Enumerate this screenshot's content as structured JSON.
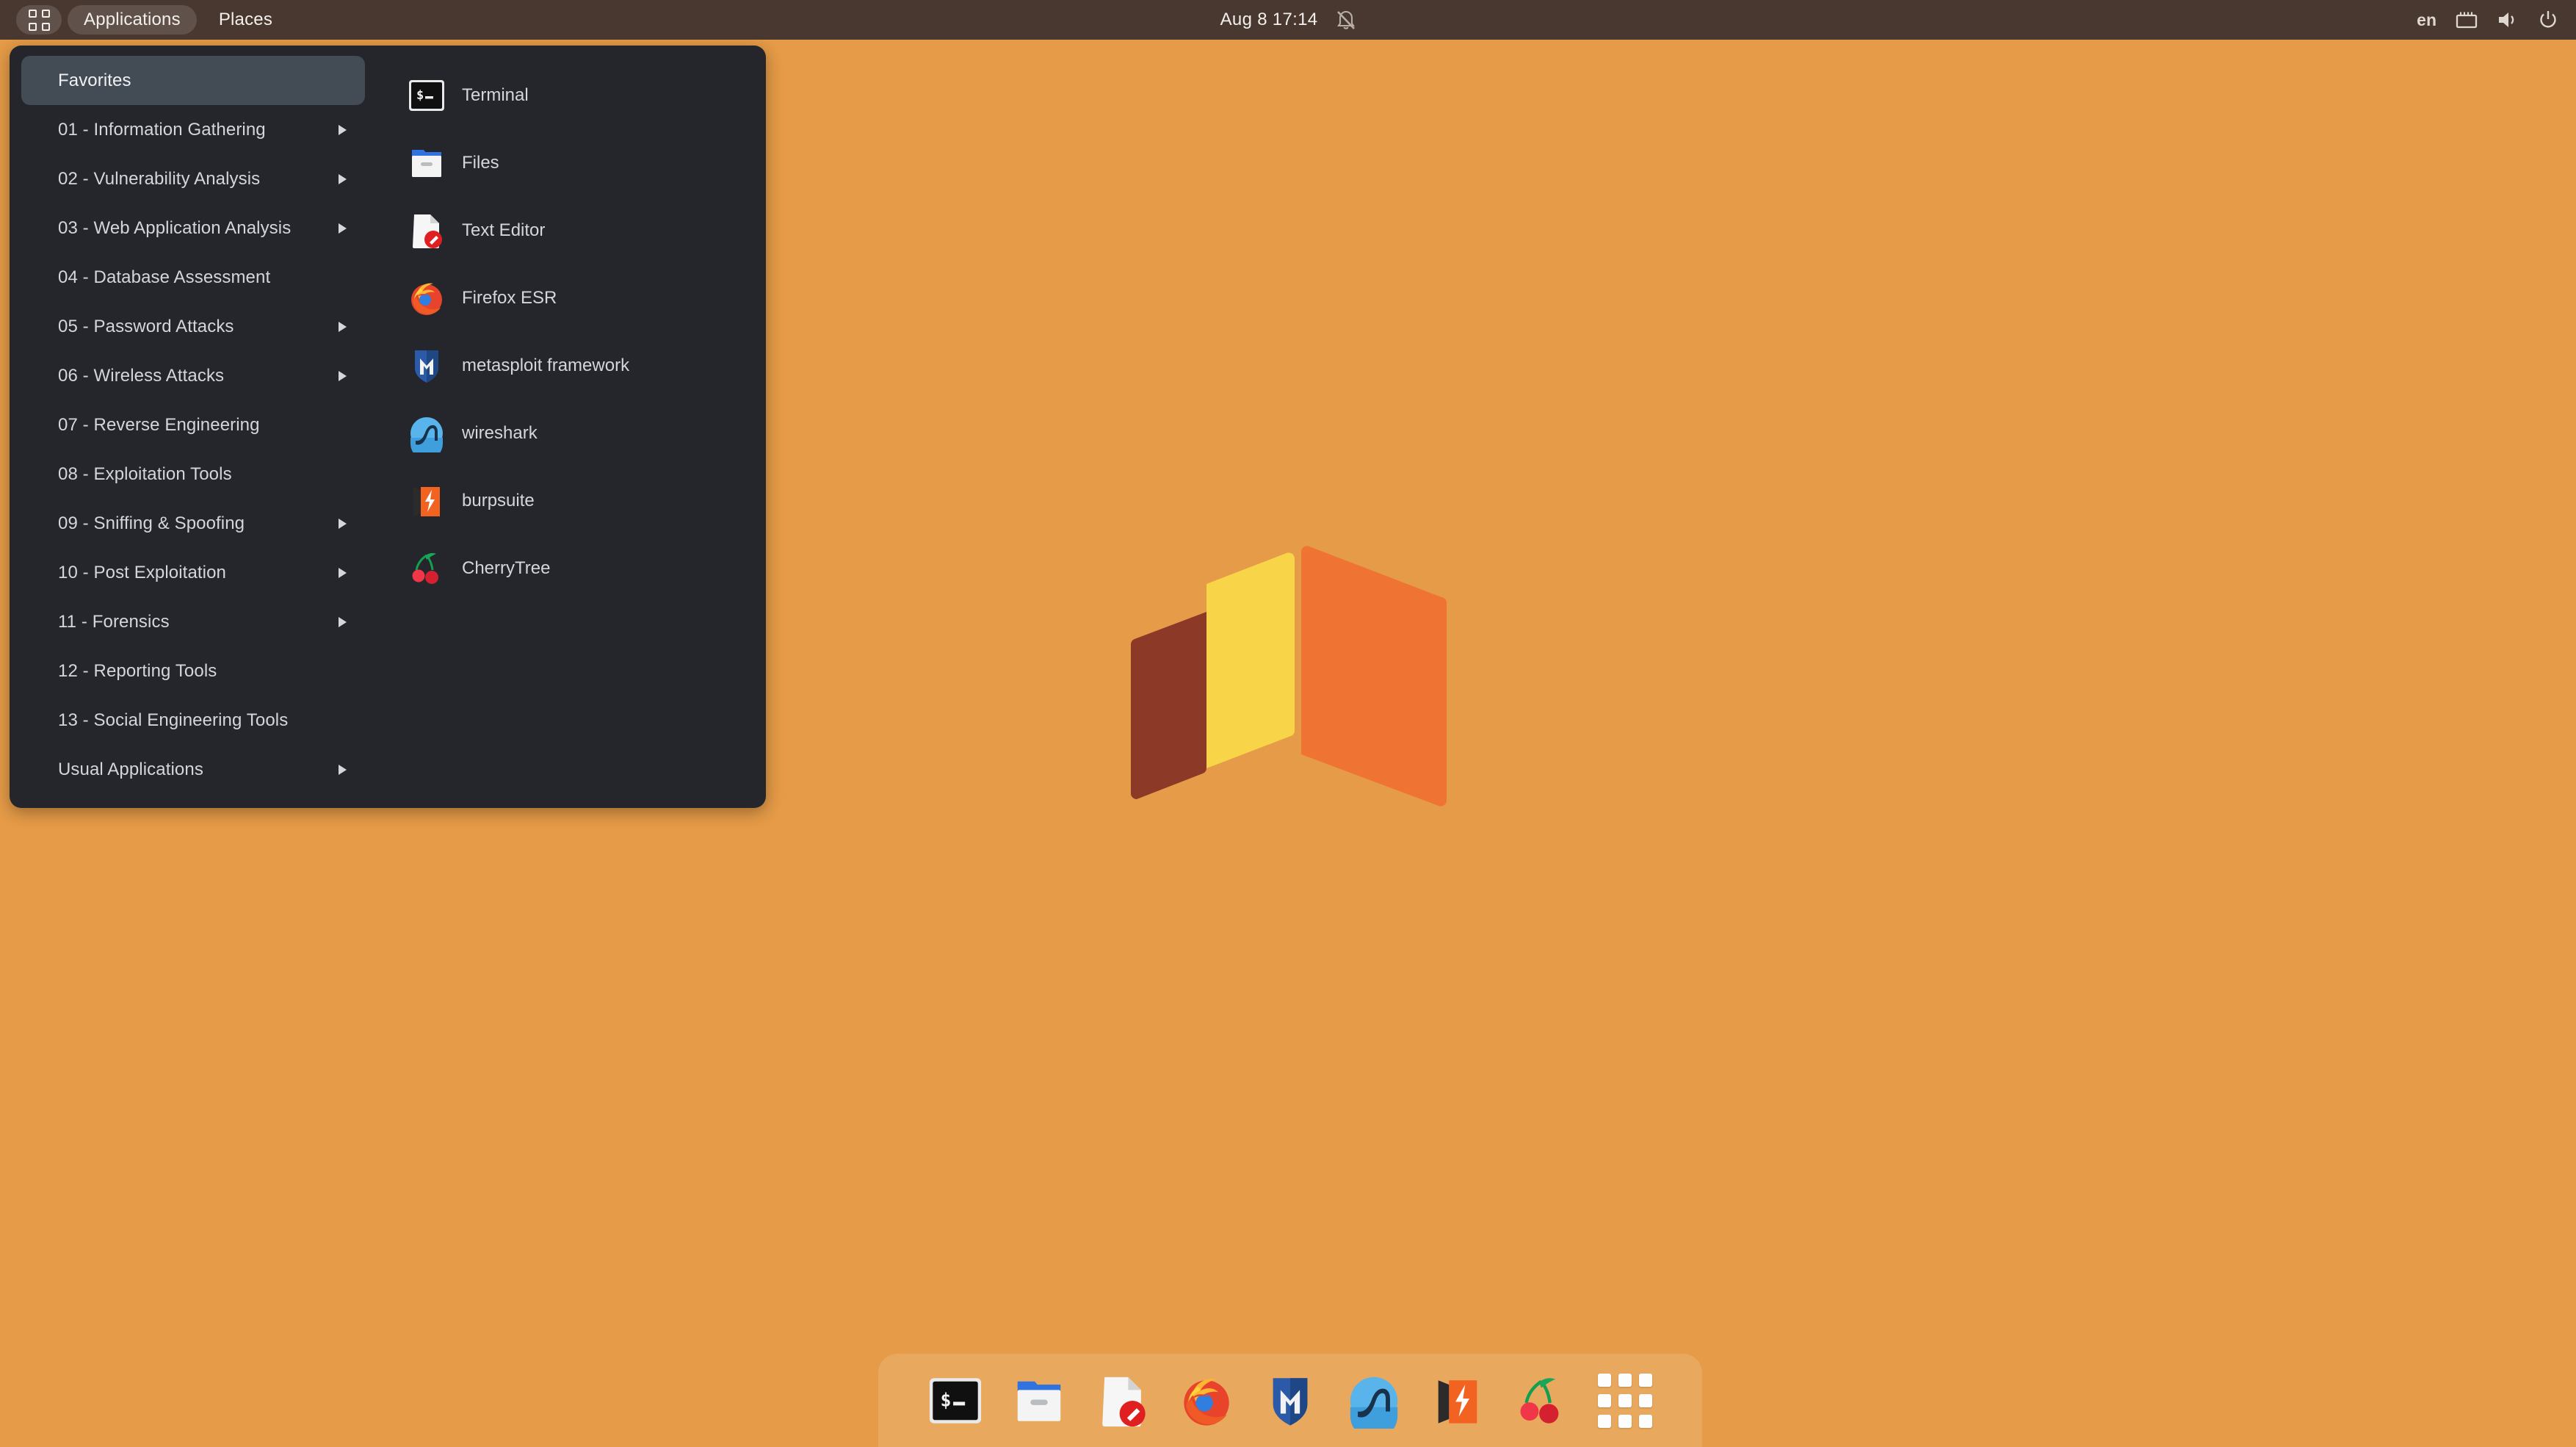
{
  "colors": {
    "desktop_background": "#e59b47",
    "topbar_background": "#493830",
    "menu_background": "#24262c",
    "menu_selection": "#434b55",
    "logo_yellow": "#f8d448",
    "logo_brown": "#8c3a27",
    "logo_orange": "#ef7434"
  },
  "topbar": {
    "grid_button": "show-applications",
    "applications_label": "Applications",
    "places_label": "Places",
    "clock": "Aug 8  17:14",
    "notification_icon": "bell-muted-icon",
    "language": "en",
    "network_icon": "wired-network-icon",
    "volume_icon": "volume-icon",
    "power_icon": "power-icon"
  },
  "app_menu": {
    "categories": [
      {
        "label": "Favorites",
        "selected": true,
        "has_submenu": false
      },
      {
        "label": "01 - Information Gathering",
        "selected": false,
        "has_submenu": true
      },
      {
        "label": "02 - Vulnerability Analysis",
        "selected": false,
        "has_submenu": true
      },
      {
        "label": "03 - Web Application Analysis",
        "selected": false,
        "has_submenu": true
      },
      {
        "label": "04 - Database Assessment",
        "selected": false,
        "has_submenu": false
      },
      {
        "label": "05 - Password Attacks",
        "selected": false,
        "has_submenu": true
      },
      {
        "label": "06 - Wireless Attacks",
        "selected": false,
        "has_submenu": true
      },
      {
        "label": "07 - Reverse Engineering",
        "selected": false,
        "has_submenu": false
      },
      {
        "label": "08 - Exploitation Tools",
        "selected": false,
        "has_submenu": false
      },
      {
        "label": "09 - Sniffing & Spoofing",
        "selected": false,
        "has_submenu": true
      },
      {
        "label": "10 - Post Exploitation",
        "selected": false,
        "has_submenu": true
      },
      {
        "label": "11 - Forensics",
        "selected": false,
        "has_submenu": true
      },
      {
        "label": "12 - Reporting Tools",
        "selected": false,
        "has_submenu": false
      },
      {
        "label": "13 - Social Engineering Tools",
        "selected": false,
        "has_submenu": false
      },
      {
        "label": "Usual Applications",
        "selected": false,
        "has_submenu": true
      }
    ],
    "applications": [
      {
        "label": "Terminal",
        "icon": "terminal-icon"
      },
      {
        "label": "Files",
        "icon": "folder-icon"
      },
      {
        "label": "Text Editor",
        "icon": "text-editor-icon"
      },
      {
        "label": "Firefox ESR",
        "icon": "firefox-icon"
      },
      {
        "label": "metasploit framework",
        "icon": "metasploit-icon"
      },
      {
        "label": "wireshark",
        "icon": "wireshark-icon"
      },
      {
        "label": "burpsuite",
        "icon": "burpsuite-icon"
      },
      {
        "label": "CherryTree",
        "icon": "cherrytree-icon"
      }
    ]
  },
  "dock": {
    "items": [
      {
        "name": "Terminal",
        "icon": "terminal-icon"
      },
      {
        "name": "Files",
        "icon": "folder-icon"
      },
      {
        "name": "Text Editor",
        "icon": "text-editor-icon"
      },
      {
        "name": "Firefox ESR",
        "icon": "firefox-icon"
      },
      {
        "name": "metasploit framework",
        "icon": "metasploit-icon"
      },
      {
        "name": "wireshark",
        "icon": "wireshark-icon"
      },
      {
        "name": "burpsuite",
        "icon": "burpsuite-icon"
      },
      {
        "name": "CherryTree",
        "icon": "cherrytree-icon"
      },
      {
        "name": "Show Applications",
        "icon": "grid-icon"
      }
    ]
  },
  "wallpaper": {
    "logo": "isometric-cube-logo"
  }
}
